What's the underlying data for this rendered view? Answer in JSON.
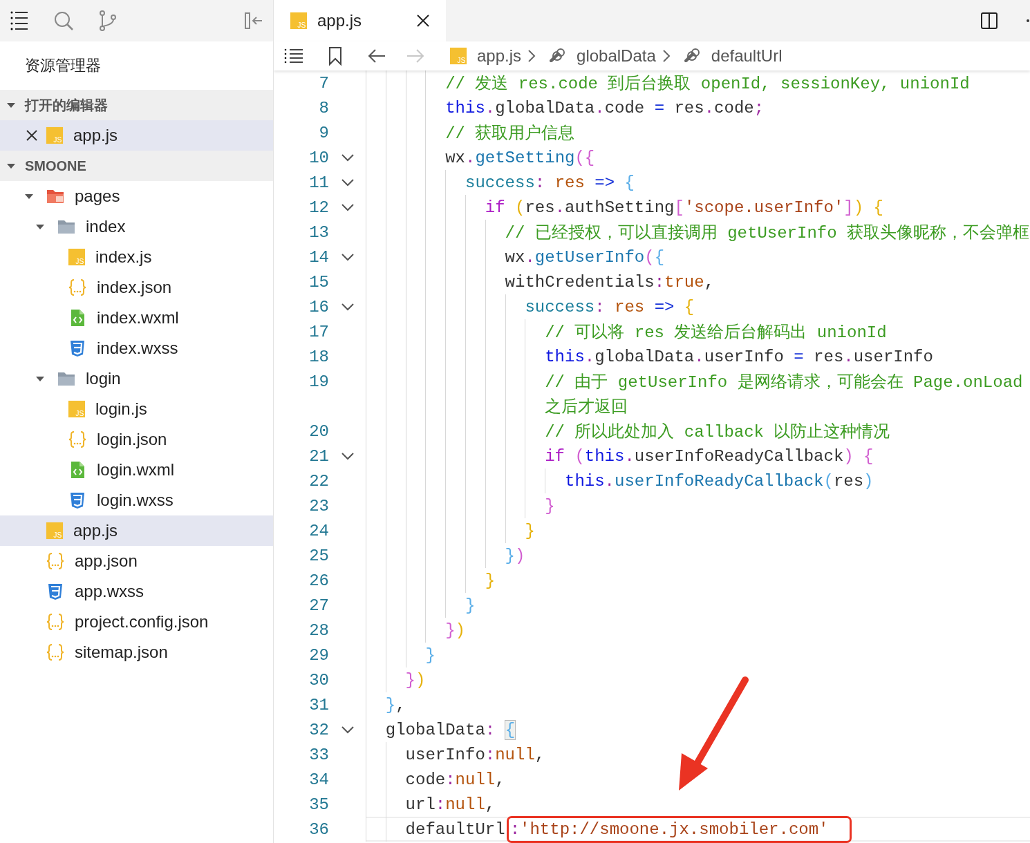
{
  "sidebar": {
    "title": "资源管理器",
    "sections": [
      {
        "kind": "open-editors",
        "title": "打开的编辑器",
        "expanded": true,
        "items": [
          {
            "name": "app.js",
            "kind": "js",
            "icon_label": "JS",
            "selected": true
          }
        ]
      },
      {
        "kind": "tree",
        "title": "SMOONE",
        "expanded": true,
        "items": [
          {
            "name": "pages",
            "kind": "pages-folder",
            "expanded": true,
            "selected": false,
            "children": [
              {
                "name": "index",
                "kind": "folder",
                "expanded": true,
                "selected": false,
                "children": [
                  {
                    "name": "index.js",
                    "kind": "js",
                    "icon_label": "JS",
                    "selected": false
                  },
                  {
                    "name": "index.json",
                    "kind": "json",
                    "selected": false
                  },
                  {
                    "name": "index.wxml",
                    "kind": "wxml",
                    "selected": false
                  },
                  {
                    "name": "index.wxss",
                    "kind": "wxss",
                    "selected": false
                  }
                ]
              },
              {
                "name": "login",
                "kind": "folder",
                "expanded": true,
                "selected": false,
                "children": [
                  {
                    "name": "login.js",
                    "kind": "js",
                    "icon_label": "JS",
                    "selected": false
                  },
                  {
                    "name": "login.json",
                    "kind": "json",
                    "selected": false
                  },
                  {
                    "name": "login.wxml",
                    "kind": "wxml",
                    "selected": false
                  },
                  {
                    "name": "login.wxss",
                    "kind": "wxss",
                    "selected": false
                  }
                ]
              }
            ]
          },
          {
            "name": "app.js",
            "kind": "js",
            "icon_label": "JS",
            "selected": true
          },
          {
            "name": "app.json",
            "kind": "json",
            "selected": false
          },
          {
            "name": "app.wxss",
            "kind": "wxss",
            "selected": false
          },
          {
            "name": "project.config.json",
            "kind": "json",
            "selected": false
          },
          {
            "name": "sitemap.json",
            "kind": "json",
            "selected": false
          }
        ]
      }
    ]
  },
  "editor": {
    "tabs": [
      {
        "label": "app.js",
        "kind": "js",
        "icon_label": "JS",
        "selected": true
      }
    ],
    "toolbar": {
      "back_enabled": true,
      "forward_enabled": false
    },
    "breadcrumb": [
      {
        "label": "app.js",
        "kind": "js",
        "icon_label": "JS"
      },
      {
        "label": "globalData",
        "kind": "property"
      },
      {
        "label": "defaultUrl",
        "kind": "property"
      }
    ],
    "lines": [
      {
        "children": [
          {
            "children": [
              {
                "children": [
                  {
                    "number": "7",
                    "foldable": false,
                    "current": false,
                    "tokens": [
                      {
                        "t": "// 发送 res.code 到后台换取 openId, sessionKey, unionId",
                        "kind": "comment"
                      }
                    ]
                  },
                  {
                    "number": "8",
                    "foldable": false,
                    "current": false,
                    "tokens": [
                      {
                        "t": "this",
                        "kind": "this"
                      },
                      {
                        "t": ".",
                        "kind": "punct"
                      },
                      {
                        "t": "globalData",
                        "kind": "plain"
                      },
                      {
                        "t": ".",
                        "kind": "punct"
                      },
                      {
                        "t": "code ",
                        "kind": "plain"
                      },
                      {
                        "t": "=",
                        "kind": "op"
                      },
                      {
                        "t": " res",
                        "kind": "plain"
                      },
                      {
                        "t": ".",
                        "kind": "punct"
                      },
                      {
                        "t": "code",
                        "kind": "plain"
                      },
                      {
                        "t": ";",
                        "kind": "punct"
                      }
                    ]
                  },
                  {
                    "number": "9",
                    "foldable": false,
                    "current": false,
                    "tokens": [
                      {
                        "t": "// 获取用户信息",
                        "kind": "comment"
                      }
                    ]
                  },
                  {
                    "number": "10",
                    "foldable": true,
                    "current": false,
                    "tokens": [
                      {
                        "t": "wx",
                        "kind": "plain"
                      },
                      {
                        "t": ".",
                        "kind": "punct"
                      },
                      {
                        "t": "getSetting",
                        "kind": "func"
                      },
                      {
                        "t": "({",
                        "kind": "b2"
                      }
                    ],
                    "children": [
                      {
                        "number": "11",
                        "foldable": true,
                        "current": false,
                        "tokens": [
                          {
                            "t": "success",
                            "kind": "prop"
                          },
                          {
                            "t": ":",
                            "kind": "punct"
                          },
                          {
                            "t": " res",
                            "kind": "param"
                          },
                          {
                            "t": " =>",
                            "kind": "op"
                          },
                          {
                            "t": " {",
                            "kind": "b3"
                          }
                        ],
                        "children": [
                          {
                            "number": "12",
                            "foldable": true,
                            "current": false,
                            "tokens": [
                              {
                                "t": "if",
                                "kind": "keyword"
                              },
                              {
                                "t": " (",
                                "kind": "b1"
                              },
                              {
                                "t": "res",
                                "kind": "plain"
                              },
                              {
                                "t": ".",
                                "kind": "punct"
                              },
                              {
                                "t": "authSetting",
                                "kind": "plain"
                              },
                              {
                                "t": "[",
                                "kind": "b2"
                              },
                              {
                                "t": "'scope.userInfo'",
                                "kind": "string"
                              },
                              {
                                "t": "]",
                                "kind": "b2"
                              },
                              {
                                "t": ")",
                                "kind": "b1"
                              },
                              {
                                "t": " {",
                                "kind": "b1"
                              }
                            ],
                            "children": [
                              {
                                "number": "13",
                                "foldable": false,
                                "current": false,
                                "tokens": [
                                  {
                                    "t": "// 已经授权，可以直接调用 getUserInfo 获取头像昵称，不会弹框",
                                    "kind": "comment"
                                  }
                                ]
                              },
                              {
                                "number": "14",
                                "foldable": true,
                                "current": false,
                                "tokens": [
                                  {
                                    "t": "wx",
                                    "kind": "plain"
                                  },
                                  {
                                    "t": ".",
                                    "kind": "punct"
                                  },
                                  {
                                    "t": "getUserInfo",
                                    "kind": "func"
                                  },
                                  {
                                    "t": "(",
                                    "kind": "b2"
                                  },
                                  {
                                    "t": "{",
                                    "kind": "b3"
                                  }
                                ]
                              },
                              {
                                "number": "15",
                                "foldable": false,
                                "current": false,
                                "tokens": [
                                  {
                                    "t": "withCredentials",
                                    "kind": "plain"
                                  },
                                  {
                                    "t": ":",
                                    "kind": "punct"
                                  },
                                  {
                                    "t": "true",
                                    "kind": "literal"
                                  },
                                  {
                                    "t": ",",
                                    "kind": "plain"
                                  }
                                ],
                                "children": [
                                  {
                                    "number": "16",
                                    "foldable": true,
                                    "current": false,
                                    "tokens": [
                                      {
                                        "t": "success",
                                        "kind": "prop"
                                      },
                                      {
                                        "t": ":",
                                        "kind": "punct"
                                      },
                                      {
                                        "t": " res",
                                        "kind": "param"
                                      },
                                      {
                                        "t": " =>",
                                        "kind": "op"
                                      },
                                      {
                                        "t": " {",
                                        "kind": "b1"
                                      }
                                    ],
                                    "children": [
                                      {
                                        "number": "17",
                                        "foldable": false,
                                        "current": false,
                                        "tokens": [
                                          {
                                            "t": "// 可以将 res 发送给后台解码出 unionId",
                                            "kind": "comment"
                                          }
                                        ]
                                      },
                                      {
                                        "number": "18",
                                        "foldable": false,
                                        "current": false,
                                        "tokens": [
                                          {
                                            "t": "this",
                                            "kind": "this"
                                          },
                                          {
                                            "t": ".",
                                            "kind": "punct"
                                          },
                                          {
                                            "t": "globalData",
                                            "kind": "plain"
                                          },
                                          {
                                            "t": ".",
                                            "kind": "punct"
                                          },
                                          {
                                            "t": "userInfo ",
                                            "kind": "plain"
                                          },
                                          {
                                            "t": "=",
                                            "kind": "op"
                                          },
                                          {
                                            "t": " res",
                                            "kind": "plain"
                                          },
                                          {
                                            "t": ".",
                                            "kind": "punct"
                                          },
                                          {
                                            "t": "userInfo",
                                            "kind": "plain"
                                          }
                                        ]
                                      },
                                      {
                                        "number": "19",
                                        "foldable": false,
                                        "current": false,
                                        "tokens": [
                                          {
                                            "t": "// 由于 getUserInfo 是网络请求，可能会在 Page.onLoad",
                                            "kind": "comment"
                                          }
                                        ],
                                        "continuation": [
                                          {
                                            "t": "之后才返回",
                                            "kind": "comment"
                                          }
                                        ]
                                      },
                                      {
                                        "number": "20",
                                        "foldable": false,
                                        "current": false,
                                        "tokens": [
                                          {
                                            "t": "// 所以此处加入 callback 以防止这种情况",
                                            "kind": "comment"
                                          }
                                        ]
                                      },
                                      {
                                        "number": "21",
                                        "foldable": true,
                                        "current": false,
                                        "tokens": [
                                          {
                                            "t": "if",
                                            "kind": "keyword"
                                          },
                                          {
                                            "t": " (",
                                            "kind": "b2"
                                          },
                                          {
                                            "t": "this",
                                            "kind": "this"
                                          },
                                          {
                                            "t": ".",
                                            "kind": "punct"
                                          },
                                          {
                                            "t": "userInfoReadyCallback",
                                            "kind": "plain"
                                          },
                                          {
                                            "t": ")",
                                            "kind": "b2"
                                          },
                                          {
                                            "t": " {",
                                            "kind": "b2"
                                          }
                                        ],
                                        "children": [
                                          {
                                            "number": "22",
                                            "foldable": false,
                                            "current": false,
                                            "tokens": [
                                              {
                                                "t": "this",
                                                "kind": "this"
                                              },
                                              {
                                                "t": ".",
                                                "kind": "punct"
                                              },
                                              {
                                                "t": "userInfoReadyCallback",
                                                "kind": "func"
                                              },
                                              {
                                                "t": "(",
                                                "kind": "b3"
                                              },
                                              {
                                                "t": "res",
                                                "kind": "plain"
                                              },
                                              {
                                                "t": ")",
                                                "kind": "b3"
                                              }
                                            ]
                                          }
                                        ]
                                      },
                                      {
                                        "number": "23",
                                        "foldable": false,
                                        "current": false,
                                        "tokens": [
                                          {
                                            "t": "}",
                                            "kind": "b2"
                                          }
                                        ]
                                      }
                                    ]
                                  },
                                  {
                                    "number": "24",
                                    "foldable": false,
                                    "current": false,
                                    "tokens": [
                                      {
                                        "t": "}",
                                        "kind": "b1"
                                      }
                                    ]
                                  }
                                ]
                              },
                              {
                                "number": "25",
                                "foldable": false,
                                "current": false,
                                "tokens": [
                                  {
                                    "t": "}",
                                    "kind": "b3"
                                  },
                                  {
                                    "t": ")",
                                    "kind": "b2"
                                  }
                                ]
                              }
                            ]
                          },
                          {
                            "number": "26",
                            "foldable": false,
                            "current": false,
                            "tokens": [
                              {
                                "t": "}",
                                "kind": "b1"
                              }
                            ]
                          }
                        ]
                      },
                      {
                        "number": "27",
                        "foldable": false,
                        "current": false,
                        "tokens": [
                          {
                            "t": "}",
                            "kind": "b3"
                          }
                        ]
                      }
                    ]
                  },
                  {
                    "number": "28",
                    "foldable": false,
                    "current": false,
                    "tokens": [
                      {
                        "t": "}",
                        "kind": "b2"
                      },
                      {
                        "t": ")",
                        "kind": "b1"
                      }
                    ]
                  }
                ]
              },
              {
                "number": "29",
                "foldable": false,
                "current": false,
                "tokens": [
                  {
                    "t": "}",
                    "kind": "b3"
                  }
                ]
              }
            ]
          },
          {
            "number": "30",
            "foldable": false,
            "current": false,
            "tokens": [
              {
                "t": "}",
                "kind": "b2"
              },
              {
                "t": ")",
                "kind": "b1"
              }
            ]
          }
        ]
      },
      {
        "number": "31",
        "foldable": false,
        "current": false,
        "tokens": [
          {
            "t": "}",
            "kind": "b3"
          },
          {
            "t": ",",
            "kind": "plain"
          }
        ]
      },
      {
        "number": "32",
        "foldable": true,
        "current": false,
        "tokens": [
          {
            "t": "globalData",
            "kind": "plain"
          },
          {
            "t": ": ",
            "kind": "punct"
          },
          {
            "t": "{",
            "kind": "b3",
            "matched": true
          }
        ],
        "children": [
          {
            "number": "33",
            "foldable": false,
            "current": false,
            "tokens": [
              {
                "t": "userInfo",
                "kind": "plain"
              },
              {
                "t": ":",
                "kind": "punct"
              },
              {
                "t": "null",
                "kind": "literal"
              },
              {
                "t": ",",
                "kind": "plain"
              }
            ]
          },
          {
            "number": "34",
            "foldable": false,
            "current": false,
            "tokens": [
              {
                "t": "code",
                "kind": "plain"
              },
              {
                "t": ":",
                "kind": "punct"
              },
              {
                "t": "null",
                "kind": "literal"
              },
              {
                "t": ",",
                "kind": "plain"
              }
            ]
          },
          {
            "number": "35",
            "foldable": false,
            "current": false,
            "tokens": [
              {
                "t": "url",
                "kind": "plain"
              },
              {
                "t": ":",
                "kind": "punct"
              },
              {
                "t": "null",
                "kind": "literal"
              },
              {
                "t": ",",
                "kind": "plain"
              }
            ]
          },
          {
            "number": "36",
            "foldable": false,
            "current": true,
            "tokens": [
              {
                "t": "defaultUrl",
                "kind": "plain"
              }
            ],
            "boxed": [
              {
                "t": ":",
                "kind": "punct"
              },
              {
                "t": "'http://smoone.jx.smobiler.com'",
                "kind": "string"
              }
            ]
          }
        ]
      }
    ]
  }
}
